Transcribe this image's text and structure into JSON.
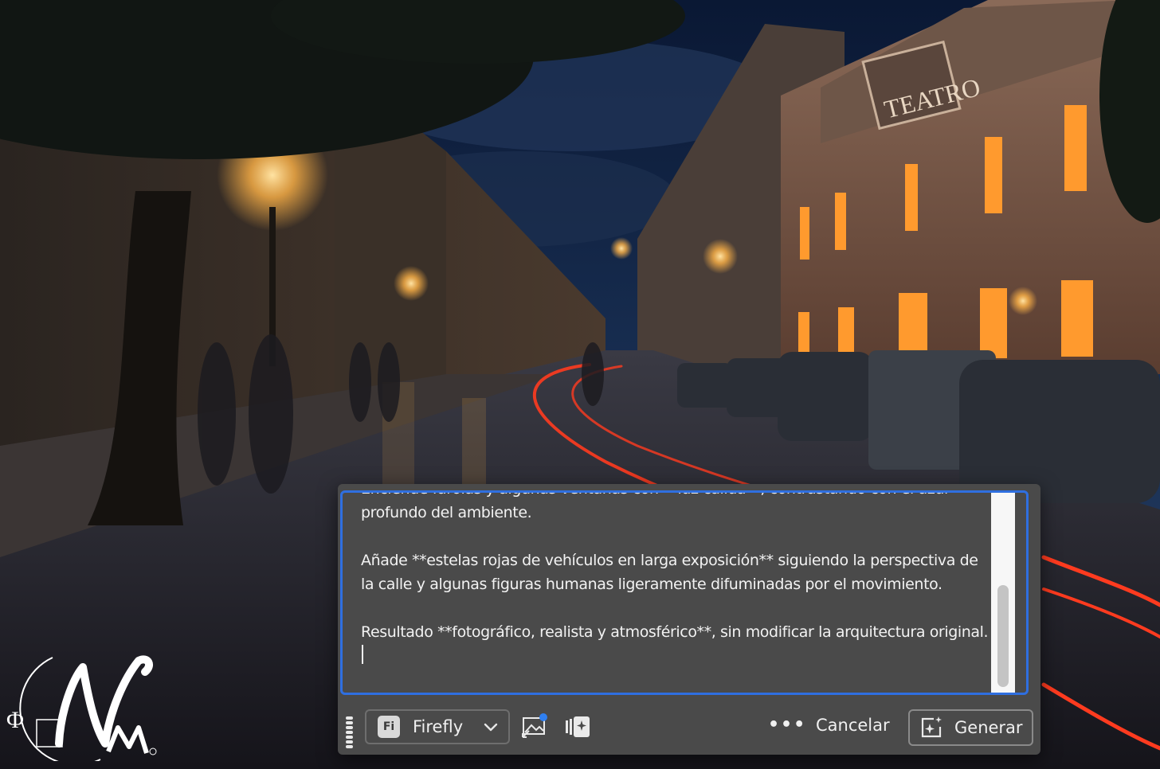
{
  "scene": {
    "sign_text": "TEATRO"
  },
  "prompt": {
    "clipped_line": "Enciende farolas y algunas ventanas con **luz cálida**, contrastando con el azul",
    "paragraph_1_end": "profundo del ambiente.",
    "paragraph_2": "Añade **estelas rojas de vehículos en larga exposición** siguiendo la perspectiva de la calle y algunas figuras humanas ligeramente difuminadas por el movimiento.",
    "paragraph_3": "Resultado **fotográfico, realista y atmosférico**, sin modificar la arquitectura original."
  },
  "toolbar": {
    "model_badge": "Fi",
    "model_label": "Firefly",
    "more_label": "•••",
    "cancel_label": "Cancelar",
    "generate_label": "Generar"
  },
  "icons": {
    "drag": "drag-handle-icon",
    "model": "firefly-badge-icon",
    "dropdown": "chevron-down-icon",
    "reference_image": "reference-image-icon",
    "style_effects": "style-effects-icon",
    "more": "more-options-icon",
    "generate": "generate-sparkle-icon"
  },
  "colors": {
    "focus_ring": "#2f6fe0",
    "panel_bg": "#4a4a4a",
    "light_trail": "#ff3b1f",
    "lamp_glow": "#ffb347"
  }
}
